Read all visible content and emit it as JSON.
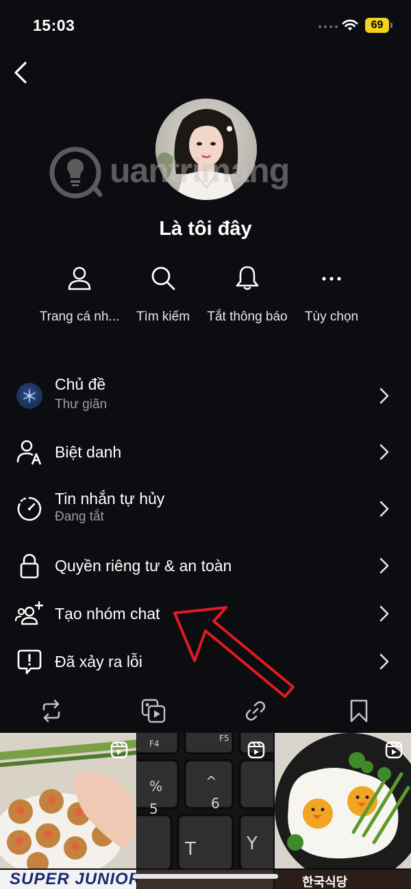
{
  "status_bar": {
    "time": "15:03",
    "battery": "69"
  },
  "profile": {
    "name": "Là tôi đây"
  },
  "watermark": {
    "text": "uantrimang"
  },
  "actions": [
    {
      "label": "Trang cá nh...",
      "icon": "person-icon"
    },
    {
      "label": "Tìm kiếm",
      "icon": "search-icon"
    },
    {
      "label": "Tắt thông báo",
      "icon": "bell-icon"
    },
    {
      "label": "Tùy chọn",
      "icon": "more-dots-icon"
    }
  ],
  "menu": [
    {
      "title": "Chủ đề",
      "subtitle": "Thư giãn",
      "icon": "theme-icon"
    },
    {
      "title": "Biệt danh",
      "icon": "nickname-icon"
    },
    {
      "title": "Tin nhắn tự hủy",
      "subtitle": "Đang tắt",
      "icon": "timer-icon"
    },
    {
      "title": "Quyền riêng tư & an toàn",
      "icon": "lock-icon"
    },
    {
      "title": "Tạo nhóm chat",
      "icon": "add-group-icon"
    },
    {
      "title": "Đã xảy ra lỗi",
      "icon": "report-problem-icon"
    }
  ],
  "tabs": [
    "repost-icon",
    "media-icon",
    "link-icon",
    "bookmark-icon"
  ],
  "grid_bottom": {
    "left_text": "SUPER JUNIOR L.S.S.",
    "right_text": "한국식당"
  },
  "colors": {
    "background": "#0c0d10",
    "battery": "#f3d21e",
    "subtitle": "#9b9ea4",
    "annotation_arrow": "#e11b22"
  }
}
